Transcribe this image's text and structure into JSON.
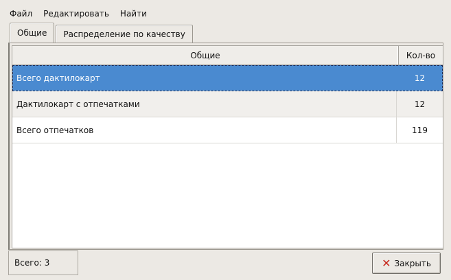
{
  "menu": {
    "items": [
      {
        "label": "Файл"
      },
      {
        "label": "Редактировать"
      },
      {
        "label": "Найти"
      }
    ]
  },
  "tabs": [
    {
      "label": "Общие"
    },
    {
      "label": "Распределение по качеству"
    }
  ],
  "table": {
    "columns": [
      "Общие",
      "Кол-во"
    ],
    "rows": [
      {
        "label": "Всего дактилокарт",
        "count": "12"
      },
      {
        "label": "Дактилокарт с отпечатками",
        "count": "12"
      },
      {
        "label": "Всего отпечатков",
        "count": "119"
      }
    ]
  },
  "status": {
    "total": "Всего: 3"
  },
  "buttons": {
    "close_label": "Закрыть",
    "close_icon": "close-icon"
  },
  "colors": {
    "selection": "#4a8ad0",
    "close_icon": "#c6281d"
  }
}
